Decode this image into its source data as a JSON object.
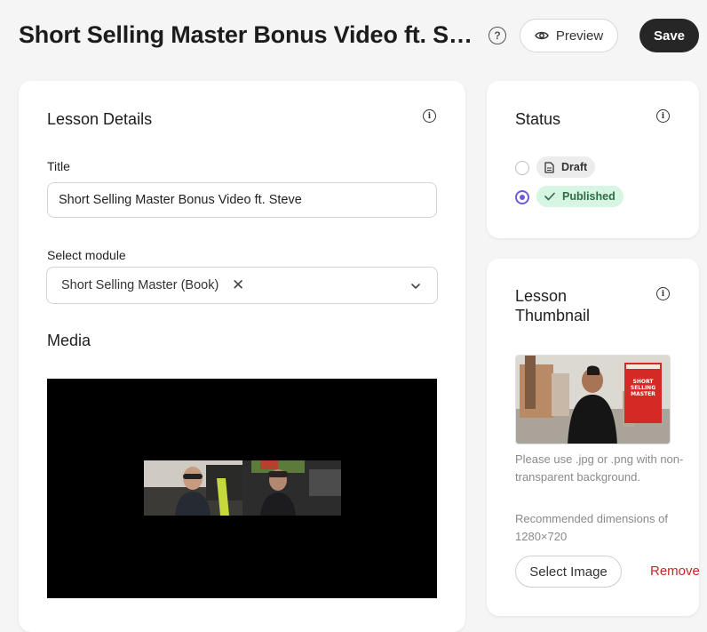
{
  "header": {
    "title": "Short Selling Master Bonus Video ft. Steve",
    "help_glyph": "?",
    "preview_label": "Preview",
    "save_label": "Save"
  },
  "lesson_details": {
    "heading": "Lesson Details",
    "title_label": "Title",
    "title_value": "Short Selling Master Bonus Video ft. Steve",
    "module_label": "Select module",
    "module_value": "Short Selling Master (Book)",
    "module_clear": "✕",
    "media_heading": "Media"
  },
  "status": {
    "heading": "Status",
    "options": [
      {
        "label": "Draft",
        "selected": false
      },
      {
        "label": "Published",
        "selected": true
      }
    ]
  },
  "thumbnail": {
    "heading": "Lesson Thumbnail",
    "book_cover_text": "SHORT SELLING MASTER",
    "hint_format": "Please use .jpg or .png with non-transparent background.",
    "hint_dimensions": "Recommended dimensions of 1280×720",
    "select_label": "Select Image",
    "remove_label": "Remove"
  },
  "colors": {
    "accent": "#6b5bd6",
    "published_bg": "#d6f5e2",
    "published_text": "#2e6b47",
    "remove": "#c62828",
    "save_bg": "#262626"
  },
  "icons": {
    "help": "question-circle-icon",
    "preview": "eye-icon",
    "info": "info-circle-icon",
    "draft": "document-icon",
    "published": "check-icon",
    "chevron": "chevron-down-icon",
    "clear": "x-icon"
  }
}
